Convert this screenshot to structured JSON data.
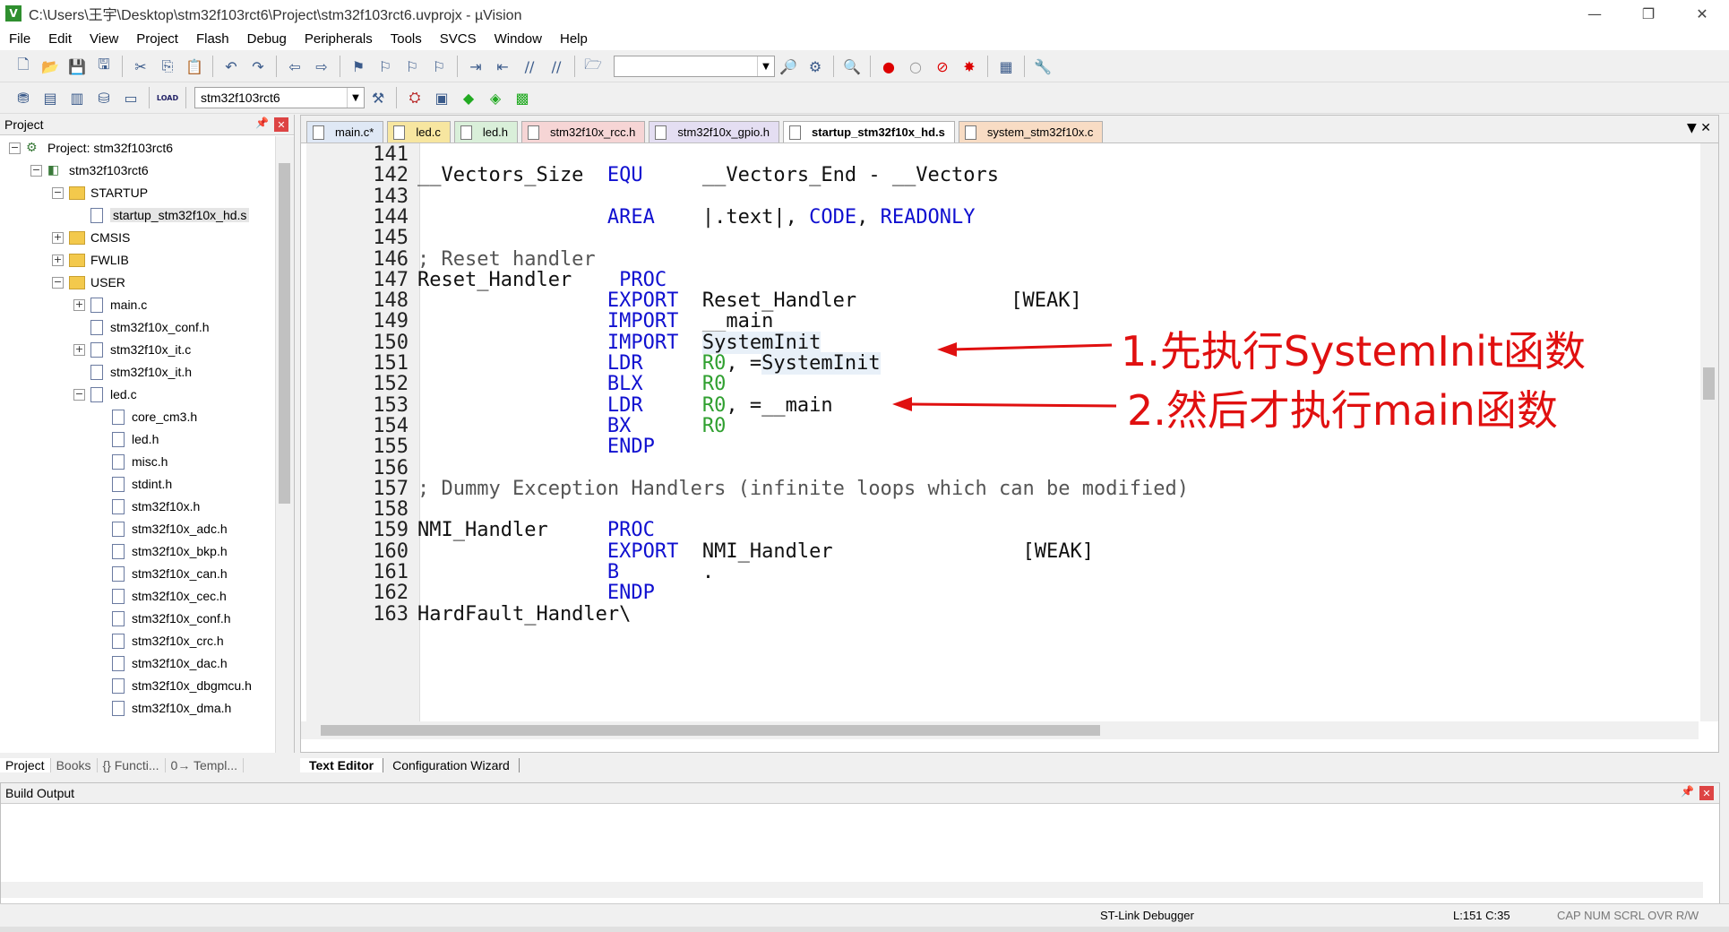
{
  "window": {
    "title": "C:\\Users\\王宇\\Desktop\\stm32f103rct6\\Project\\stm32f103rct6.uvprojx - µVision",
    "controls": [
      "—",
      "❐",
      "✕"
    ]
  },
  "menu": [
    "File",
    "Edit",
    "View",
    "Project",
    "Flash",
    "Debug",
    "Peripherals",
    "Tools",
    "SVCS",
    "Window",
    "Help"
  ],
  "toolbar2": {
    "target": "stm32f103rct6",
    "load_label": "LOAD"
  },
  "project_panel": {
    "title": "Project",
    "tree": [
      {
        "label": "Project: stm32f103rct6",
        "level": 0,
        "type": "project",
        "expander": "−"
      },
      {
        "label": "stm32f103rct6",
        "level": 1,
        "type": "target",
        "expander": "−"
      },
      {
        "label": "STARTUP",
        "level": 2,
        "type": "folder",
        "expander": "−"
      },
      {
        "label": "startup_stm32f10x_hd.s",
        "level": 3,
        "type": "file",
        "expander": "",
        "selected": true
      },
      {
        "label": "CMSIS",
        "level": 2,
        "type": "folder",
        "expander": "+"
      },
      {
        "label": "FWLIB",
        "level": 2,
        "type": "folder",
        "expander": "+"
      },
      {
        "label": "USER",
        "level": 2,
        "type": "folder",
        "expander": "−"
      },
      {
        "label": "main.c",
        "level": 3,
        "type": "file",
        "expander": "+"
      },
      {
        "label": "stm32f10x_conf.h",
        "level": 3,
        "type": "file",
        "expander": ""
      },
      {
        "label": "stm32f10x_it.c",
        "level": 3,
        "type": "file",
        "expander": "+"
      },
      {
        "label": "stm32f10x_it.h",
        "level": 3,
        "type": "file",
        "expander": ""
      },
      {
        "label": "led.c",
        "level": 3,
        "type": "file",
        "expander": "−"
      },
      {
        "label": "core_cm3.h",
        "level": 4,
        "type": "file",
        "expander": ""
      },
      {
        "label": "led.h",
        "level": 4,
        "type": "file",
        "expander": ""
      },
      {
        "label": "misc.h",
        "level": 4,
        "type": "file",
        "expander": ""
      },
      {
        "label": "stdint.h",
        "level": 4,
        "type": "file",
        "expander": ""
      },
      {
        "label": "stm32f10x.h",
        "level": 4,
        "type": "file",
        "expander": ""
      },
      {
        "label": "stm32f10x_adc.h",
        "level": 4,
        "type": "file",
        "expander": ""
      },
      {
        "label": "stm32f10x_bkp.h",
        "level": 4,
        "type": "file",
        "expander": ""
      },
      {
        "label": "stm32f10x_can.h",
        "level": 4,
        "type": "file",
        "expander": ""
      },
      {
        "label": "stm32f10x_cec.h",
        "level": 4,
        "type": "file",
        "expander": ""
      },
      {
        "label": "stm32f10x_conf.h",
        "level": 4,
        "type": "file",
        "expander": ""
      },
      {
        "label": "stm32f10x_crc.h",
        "level": 4,
        "type": "file",
        "expander": ""
      },
      {
        "label": "stm32f10x_dac.h",
        "level": 4,
        "type": "file",
        "expander": ""
      },
      {
        "label": "stm32f10x_dbgmcu.h",
        "level": 4,
        "type": "file",
        "expander": ""
      },
      {
        "label": "stm32f10x_dma.h",
        "level": 4,
        "type": "file",
        "expander": ""
      }
    ],
    "bottom_tabs": [
      "Project",
      "Books",
      "{} Functi...",
      "0→ Templ..."
    ]
  },
  "editor": {
    "tabs": [
      {
        "label": "main.c*",
        "color": "#dfe8f5"
      },
      {
        "label": "led.c",
        "color": "#f7e6a0"
      },
      {
        "label": "led.h",
        "color": "#d9efd9"
      },
      {
        "label": "stm32f10x_rcc.h",
        "color": "#f6d5d5"
      },
      {
        "label": "stm32f10x_gpio.h",
        "color": "#e4def2"
      },
      {
        "label": "startup_stm32f10x_hd.s",
        "color": "#ffffff",
        "active": true
      },
      {
        "label": "system_stm32f10x.c",
        "color": "#f8dcc4"
      }
    ],
    "tab_controls": "▼ ✕",
    "lines": [
      {
        "n": "141",
        "segs": []
      },
      {
        "n": "142",
        "segs": [
          {
            "t": "__Vectors_Size  "
          },
          {
            "t": "EQU",
            "c": "kw"
          },
          {
            "t": "     __Vectors_End - __Vectors"
          }
        ]
      },
      {
        "n": "143",
        "segs": []
      },
      {
        "n": "144",
        "segs": [
          {
            "t": "                "
          },
          {
            "t": "AREA",
            "c": "kw"
          },
          {
            "t": "    |.text|, "
          },
          {
            "t": "CODE",
            "c": "kw"
          },
          {
            "t": ", "
          },
          {
            "t": "READONLY",
            "c": "kw"
          }
        ]
      },
      {
        "n": "145",
        "segs": []
      },
      {
        "n": "146",
        "segs": [
          {
            "t": "; Reset handler",
            "c": "cm"
          }
        ]
      },
      {
        "n": "147",
        "segs": [
          {
            "t": "Reset_Handler    "
          },
          {
            "t": "PROC",
            "c": "kw"
          }
        ]
      },
      {
        "n": "148",
        "segs": [
          {
            "t": "                "
          },
          {
            "t": "EXPORT",
            "c": "kw"
          },
          {
            "t": "  Reset_Handler             [WEAK]"
          }
        ]
      },
      {
        "n": "149",
        "segs": [
          {
            "t": "                "
          },
          {
            "t": "IMPORT",
            "c": "kw"
          },
          {
            "t": "  __main"
          }
        ]
      },
      {
        "n": "150",
        "segs": [
          {
            "t": "                "
          },
          {
            "t": "IMPORT",
            "c": "kw"
          },
          {
            "t": "  "
          },
          {
            "t": "SystemInit",
            "c": "hl"
          }
        ]
      },
      {
        "n": "151",
        "segs": [
          {
            "t": "                "
          },
          {
            "t": "LDR",
            "c": "kw"
          },
          {
            "t": "     "
          },
          {
            "t": "R0",
            "c": "nm"
          },
          {
            "t": ", ="
          },
          {
            "t": "SystemInit",
            "c": "hl"
          }
        ]
      },
      {
        "n": "152",
        "segs": [
          {
            "t": "                "
          },
          {
            "t": "BLX",
            "c": "kw"
          },
          {
            "t": "     "
          },
          {
            "t": "R0",
            "c": "nm"
          }
        ]
      },
      {
        "n": "153",
        "segs": [
          {
            "t": "                "
          },
          {
            "t": "LDR",
            "c": "kw"
          },
          {
            "t": "     "
          },
          {
            "t": "R0",
            "c": "nm"
          },
          {
            "t": ", =__main"
          }
        ]
      },
      {
        "n": "154",
        "segs": [
          {
            "t": "                "
          },
          {
            "t": "BX",
            "c": "kw"
          },
          {
            "t": "      "
          },
          {
            "t": "R0",
            "c": "nm"
          }
        ]
      },
      {
        "n": "155",
        "segs": [
          {
            "t": "                "
          },
          {
            "t": "ENDP",
            "c": "kw"
          }
        ]
      },
      {
        "n": "156",
        "segs": []
      },
      {
        "n": "157",
        "segs": [
          {
            "t": "; Dummy Exception Handlers (infinite loops which can be modified)",
            "c": "cm"
          }
        ]
      },
      {
        "n": "158",
        "segs": []
      },
      {
        "n": "159",
        "segs": [
          {
            "t": "NMI_Handler     "
          },
          {
            "t": "PROC",
            "c": "kw"
          }
        ]
      },
      {
        "n": "160",
        "segs": [
          {
            "t": "                "
          },
          {
            "t": "EXPORT",
            "c": "kw"
          },
          {
            "t": "  NMI_Handler                [WEAK]"
          }
        ]
      },
      {
        "n": "161",
        "segs": [
          {
            "t": "                "
          },
          {
            "t": "B",
            "c": "kw"
          },
          {
            "t": "       ."
          }
        ]
      },
      {
        "n": "162",
        "segs": [
          {
            "t": "                "
          },
          {
            "t": "ENDP",
            "c": "kw"
          }
        ]
      },
      {
        "n": "163",
        "segs": [
          {
            "t": "HardFault_Handler\\"
          }
        ]
      }
    ],
    "annotations": [
      "1.先执行SystemInit函数",
      "2.然后才执行main函数"
    ],
    "bottom_tabs": [
      "Text Editor",
      "Configuration Wizard"
    ]
  },
  "build_output": {
    "title": "Build Output"
  },
  "status": {
    "debugger": "ST-Link Debugger",
    "position": "L:151 C:35",
    "indicators": "CAP  NUM  SCRL  OVR  R/W"
  },
  "colors": {
    "keyword": "#1010d0",
    "register": "#30a030",
    "annotation": "#e01010"
  }
}
